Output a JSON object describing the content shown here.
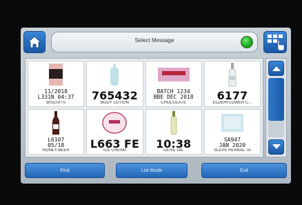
{
  "header": {
    "title": "Select Message",
    "home_icon": "home-icon",
    "status_color": "#1faa22",
    "grid_icon": "grid-touch-icon"
  },
  "messages": [
    {
      "code": "11/2018\nL331N 04:37",
      "code_size": "small",
      "name": "BISCUITS",
      "thumb": "biscuit-box"
    },
    {
      "code": "765432",
      "code_size": "big",
      "name": "BODY LOTION",
      "thumb": "lotion-bottle"
    },
    {
      "code": "BATCH 1234\nBBE DEC 2018",
      "code_size": "small",
      "name": "CHOCOLATE",
      "thumb": "chocolate-bar"
    },
    {
      "code": "6177",
      "code_size": "big",
      "name": "ELDERFLOWER C...",
      "thumb": "glass-bottle"
    },
    {
      "code": "L6107\n05/18",
      "code_size": "small",
      "name": "HONEY BEER",
      "thumb": "beer-bottle"
    },
    {
      "code": "L663 FE",
      "code_size": "big",
      "name": "ICE CREAM",
      "thumb": "ice-cream-tub"
    },
    {
      "code": "10:38",
      "code_size": "big",
      "name": "OLIVE OIL",
      "thumb": "oil-bottle"
    },
    {
      "code": "SA947\nJAN 2020",
      "code_size": "small",
      "name": "SLEPE HERBAL TA",
      "thumb": "tea-box"
    }
  ],
  "scrollbar": {
    "position_fraction": 0.0,
    "visible_fraction": 0.72
  },
  "buttons": {
    "find": "Find",
    "list_mode": "List Mode",
    "exit": "Exit"
  }
}
